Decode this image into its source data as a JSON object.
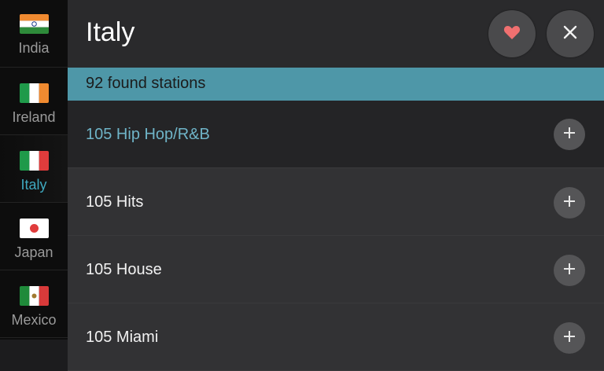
{
  "sidebar": {
    "items": [
      {
        "label": "India",
        "flag_icon": "india-flag-icon"
      },
      {
        "label": "Ireland",
        "flag_icon": "ireland-flag-icon"
      },
      {
        "label": "Italy",
        "flag_icon": "italy-flag-icon",
        "selected": true
      },
      {
        "label": "Japan",
        "flag_icon": "japan-flag-icon"
      },
      {
        "label": "Mexico",
        "flag_icon": "mexico-flag-icon"
      }
    ]
  },
  "header": {
    "title": "Italy",
    "favorite_icon": "heart-icon",
    "close_icon": "close-icon"
  },
  "status": {
    "found_text": "92 found stations"
  },
  "stations": [
    {
      "name": "105 Hip Hop/R&B",
      "highlighted": true
    },
    {
      "name": "105 Hits"
    },
    {
      "name": "105 House"
    },
    {
      "name": "105 Miami"
    }
  ],
  "colors": {
    "accent": "#4e97a8",
    "selected_text": "#3fa9c0",
    "heart": "#f07070"
  }
}
